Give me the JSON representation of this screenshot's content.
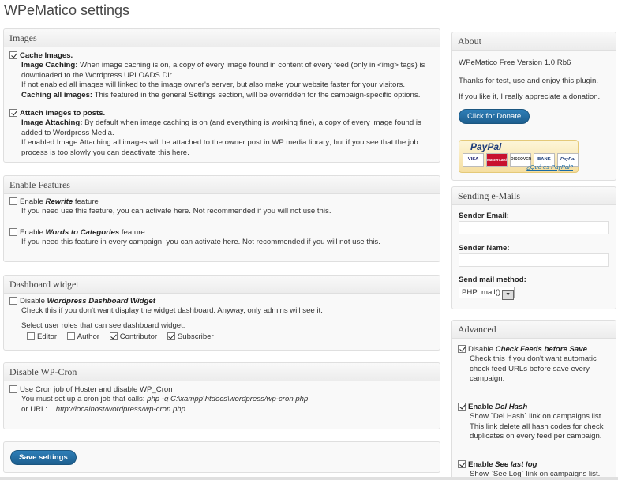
{
  "page_title": "WPeMatico settings",
  "images": {
    "title": "Images",
    "cache_label": "Cache Images.",
    "cache_desc_title": "Image Caching:",
    "cache_desc": " When image caching is on, a copy of every image found in content of every feed (only in <img> tags) is downloaded to the Wordpress UPLOADS Dir.",
    "cache_note": "If not enabled all images will linked to the image owner's server, but also make your website faster for your visitors.",
    "cache_all_title": "Caching all images:",
    "cache_all_desc": " This featured in the general Settings section, will be overridden for the campaign-specific options.",
    "attach_label": "Attach Images to posts.",
    "attach_desc_title": "Image Attaching:",
    "attach_desc": " By default when image caching is on (and everything is working fine), a copy of every image found is added to Wordpress Media.",
    "attach_note": "If enabled Image Attaching all images will be attached to the owner post in WP media library; but if you see that the job process is too slowly you can deactivate this here."
  },
  "features": {
    "title": "Enable Features",
    "rewrite_pre": "Enable ",
    "rewrite_em": "Rewrite",
    "rewrite_post": " feature",
    "rewrite_desc": "If you need use this feature, you can activate here. Not recommended if you will not use this.",
    "w2c_pre": "Enable ",
    "w2c_em": "Words to Categories",
    "w2c_post": " feature",
    "w2c_desc": "If you need this feature in every campaign, you can activate here. Not recommended if you will not use this."
  },
  "dashboard": {
    "title": "Dashboard widget",
    "disable_pre": "Disable ",
    "disable_em": "Wordpress Dashboard Widget",
    "disable_desc": "Check this if you don't want display the widget dashboard. Anyway, only admins will see it.",
    "roles_label": "Select user roles that can see dashboard widget:",
    "roles": [
      "Editor",
      "Author",
      "Contributor",
      "Subscriber"
    ]
  },
  "cron": {
    "title": "Disable WP-Cron",
    "use_label": "Use Cron job of Hoster and disable WP_Cron",
    "must_label": "You must set up a cron job that calls: ",
    "must_cmd": "php -q C:\\xampp\\htdocs\\wordpress/wp-cron.php",
    "url_label": "or URL:   ",
    "url_value": "http://localhost/wordpress/wp-cron.php"
  },
  "save_button": "Save settings",
  "about": {
    "title": "About",
    "version": "WPeMatico Free Version 1.0 Rb6",
    "thanks": "Thanks for test, use and enjoy this plugin.",
    "donation_text": "If you like it, I really appreciate a donation.",
    "donate_button": "Click for Donate",
    "paypal_logo": "PayPal",
    "paypal_cards": [
      "VISA",
      "MasterCard",
      "DISCOVER",
      "BANK",
      "PayPal"
    ],
    "paypal_link": "¿Qué es PayPal?"
  },
  "emails": {
    "title": "Sending e-Mails",
    "sender_email_label": "Sender Email:",
    "sender_email_value": "",
    "sender_name_label": "Sender Name:",
    "sender_name_value": "",
    "method_label": "Send mail method:",
    "method_value": "PHP: mail()"
  },
  "advanced": {
    "title": "Advanced",
    "checkfeeds_pre": "Disable ",
    "checkfeeds_em": "Check Feeds before Save",
    "checkfeeds_desc": "Check this if you don't want automatic check feed URLs before save every campaign.",
    "delhash_pre": "Enable ",
    "delhash_em": "Del Hash",
    "delhash_desc": "Show `Del Hash` link on campaigns list. This link delete all hash codes for check duplicates on every feed per campaign.",
    "lastlog_pre": "Enable ",
    "lastlog_em": "See last log",
    "lastlog_desc": "Show `See Log` link on campaigns list."
  }
}
